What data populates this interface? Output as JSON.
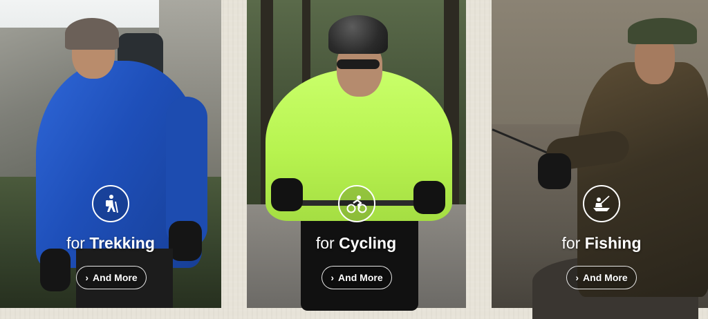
{
  "panels": [
    {
      "prefix": "for",
      "activity": "Trekking",
      "button_label": "And More",
      "icon": "hiker-icon"
    },
    {
      "prefix": "for",
      "activity": "Cycling",
      "button_label": "And More",
      "icon": "cyclist-icon"
    },
    {
      "prefix": "for",
      "activity": "Fishing",
      "button_label": "And More",
      "icon": "fishing-icon"
    }
  ],
  "colors": {
    "page_background": "#e7e3d8",
    "overlay_text": "#ffffff"
  }
}
